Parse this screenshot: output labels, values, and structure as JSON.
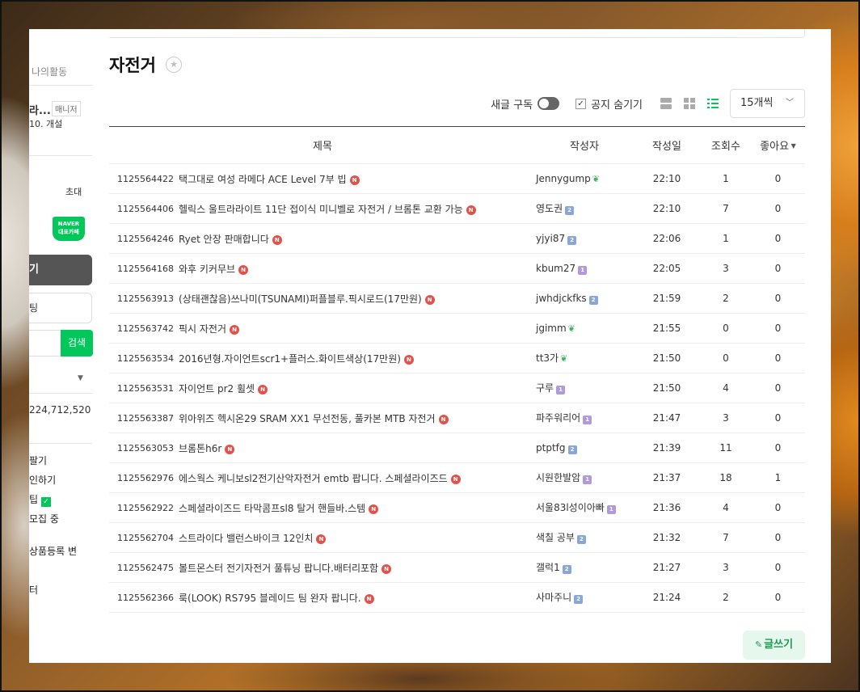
{
  "sidebar": {
    "my_activity": "나의활동",
    "cafe_name": "라...",
    "manager_badge": "매니저",
    "open_date": "10. 개설",
    "invite": "초대",
    "naver_badge_line1": "NAVER",
    "naver_badge_line2": "대표카페",
    "write_button": "기",
    "chat_button": "팅",
    "search_button": "검색",
    "member_count": "224,712,520",
    "menu_items": [
      "팔기",
      "인하기",
      "팁",
      "모집 중",
      "상품등록 변",
      "터"
    ]
  },
  "board": {
    "title": "자전거",
    "subscribe_label": "새글 구독",
    "hide_notice_label": "공지 숨기기",
    "per_page": "15개씩",
    "columns": {
      "title": "제목",
      "author": "작성자",
      "date": "작성일",
      "views": "조회수",
      "likes": "좋아요"
    },
    "write_button": "글쓰기",
    "rows": [
      {
        "num": "1125564422",
        "title": "택그대로 여성 라메다 ACE Level 7부 빕",
        "author": "Jennygump",
        "badge": "sprout",
        "date": "22:10",
        "views": "1",
        "likes": "0"
      },
      {
        "num": "1125564406",
        "title": "헬릭스 울트라라이트 11단 접이식 미니벨로 자전거 / 브롬톤 교환 가능",
        "author": "영도권",
        "badge": "blue",
        "date": "22:10",
        "views": "7",
        "likes": "0"
      },
      {
        "num": "1125564246",
        "title": "Ryet 안장 판매합니다",
        "author": "yjyi87",
        "badge": "blue",
        "date": "22:06",
        "views": "1",
        "likes": "0"
      },
      {
        "num": "1125564168",
        "title": "와후 키커무브",
        "author": "kbum27",
        "badge": "purple",
        "date": "22:05",
        "views": "3",
        "likes": "0"
      },
      {
        "num": "1125563913",
        "title": "(상태괜찮음)쓰나미(TSUNAMI)퍼플블루.픽시로드(17만원)",
        "author": "jwhdjckfks",
        "badge": "blue",
        "date": "21:59",
        "views": "2",
        "likes": "0"
      },
      {
        "num": "1125563742",
        "title": "픽시 자전거",
        "author": "jgimm",
        "badge": "sprout",
        "date": "21:55",
        "views": "0",
        "likes": "0"
      },
      {
        "num": "1125563534",
        "title": "2016년형.자이언트scr1+플러스.화이트색상(17만원)",
        "author": "tt3가",
        "badge": "sprout",
        "date": "21:50",
        "views": "0",
        "likes": "0"
      },
      {
        "num": "1125563531",
        "title": "자이언트 pr2 휠셋",
        "author": "구루",
        "badge": "purple",
        "date": "21:50",
        "views": "4",
        "likes": "0"
      },
      {
        "num": "1125563387",
        "title": "위아위즈 헥시온29 SRAM XX1 무선전동, 풀카본 MTB 자전거",
        "author": "파주워리어",
        "badge": "purple",
        "date": "21:47",
        "views": "3",
        "likes": "0"
      },
      {
        "num": "1125563053",
        "title": "브롬톤h6r",
        "author": "ptptfg",
        "badge": "blue",
        "date": "21:39",
        "views": "11",
        "likes": "0"
      },
      {
        "num": "1125562976",
        "title": "에스웍스 케니보sl2전기산악자전거 emtb 팝니다. 스페셜라이즈드",
        "author": "시원한발암",
        "badge": "purple",
        "date": "21:37",
        "views": "18",
        "likes": "1"
      },
      {
        "num": "1125562922",
        "title": "스페셜라이즈드 타막콤프sl8 탈거 핸들바.스템",
        "author": "서울83l성이아빠",
        "badge": "purple",
        "date": "21:36",
        "views": "4",
        "likes": "0"
      },
      {
        "num": "1125562704",
        "title": "스트라이다 밸런스바이크 12인치",
        "author": "색칠 공부",
        "badge": "blue",
        "date": "21:32",
        "views": "7",
        "likes": "0"
      },
      {
        "num": "1125562475",
        "title": "볼트몬스터 전기자전거 풀튜닝 팝니다.배터리포함",
        "author": "갤럭1",
        "badge": "blue",
        "date": "21:27",
        "views": "3",
        "likes": "0"
      },
      {
        "num": "1125562366",
        "title": "룩(LOOK) RS795 블레이드 팀 완자 팝니다.",
        "author": "사마주니",
        "badge": "blue",
        "date": "21:24",
        "views": "2",
        "likes": "0"
      }
    ]
  }
}
